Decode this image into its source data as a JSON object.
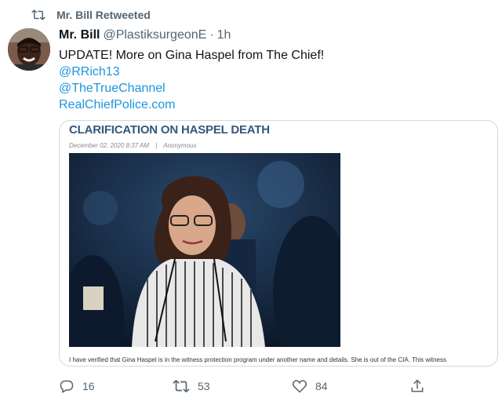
{
  "retweet": {
    "label": "Mr. Bill Retweeted"
  },
  "tweet": {
    "display_name": "Mr. Bill",
    "handle": "@PlastiksurgeonE",
    "separator": "·",
    "time": "1h",
    "text_line1": "UPDATE! More on Gina Haspel from The Chief!",
    "mention1": "@RRich13",
    "mention2": "@TheTrueChannel",
    "link": "RealChiefPolice.com"
  },
  "card": {
    "title": "CLARIFICATION ON HASPEL DEATH",
    "date": "December 02, 2020 8:37 AM",
    "meta_sep": "|",
    "author": "Anonymous",
    "body": "I have verified that Gina Haspel is in the witness protection program under another name and details. She is out of the CIA. This witness"
  },
  "actions": {
    "reply_count": "16",
    "retweet_count": "53",
    "like_count": "84"
  },
  "colors": {
    "link": "#1b95e0",
    "secondary": "#536471",
    "card_title": "#31587d"
  }
}
